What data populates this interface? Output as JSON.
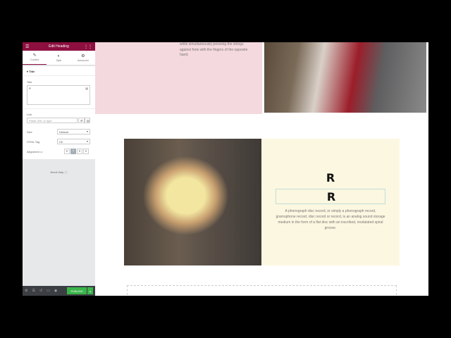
{
  "panel": {
    "title": "Edit Heading",
    "menu_icon": "hamburger-icon",
    "grid_icon": "grid-icon",
    "tabs": [
      {
        "label": "Content",
        "icon": "pencil-icon"
      },
      {
        "label": "Style",
        "icon": "contrast-icon"
      },
      {
        "label": "Advanced",
        "icon": "gear-icon"
      }
    ],
    "section": "Title",
    "title_label": "Title",
    "title_value": "R",
    "link_label": "Link",
    "link_placeholder": "Paste URL or type",
    "size_label": "Size",
    "size_value": "Default",
    "tag_label": "HTML Tag",
    "tag_value": "H2",
    "alignment_label": "Alignment",
    "alignment_selected": "center",
    "help": "Need Help",
    "publish": "PUBLISH",
    "accent": "#8c0f3f",
    "publish_color": "#39b54a"
  },
  "canvas": {
    "pink_text": "while simultaneously pressing the strings against frets with the fingers of the opposite hand.",
    "heading1": "R",
    "heading2": "R",
    "description": "A phonograph disc record, or simply a phonograph record, gramophone record, disc record or record, is an analog sound storage medium in the form of a flat disc with an inscribed, modulated spiral groove."
  }
}
